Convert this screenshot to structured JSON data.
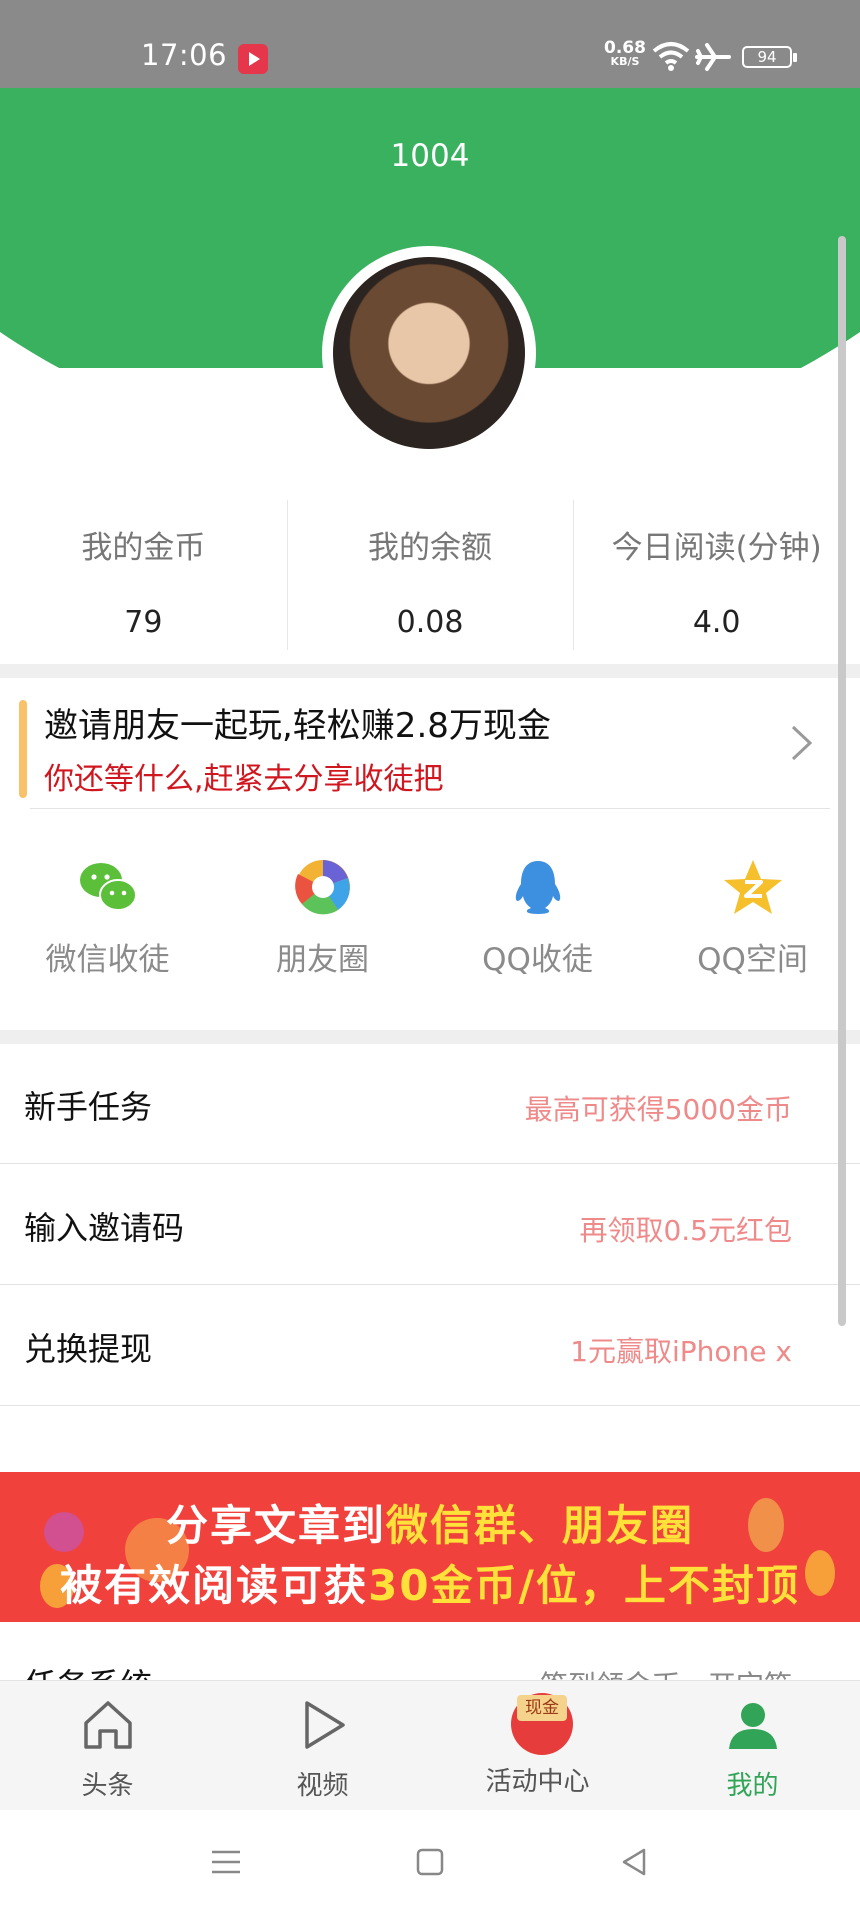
{
  "status_bar": {
    "time": "17:06",
    "speed_value": "0.68",
    "speed_unit": "KB/S",
    "battery": "94"
  },
  "header": {
    "title": "1004"
  },
  "stats": [
    {
      "label": "我的金币",
      "value": "79"
    },
    {
      "label": "我的余额",
      "value": "0.08"
    },
    {
      "label": "今日阅读(分钟)",
      "value": "4.0"
    }
  ],
  "invite": {
    "title": "邀请朋友一起玩,轻松赚2.8万现金",
    "subtitle": "你还等什么,赶紧去分享收徒把"
  },
  "share": [
    {
      "label": "微信收徒",
      "icon": "wechat-icon"
    },
    {
      "label": "朋友圈",
      "icon": "moments-icon"
    },
    {
      "label": "QQ收徒",
      "icon": "qq-icon"
    },
    {
      "label": "QQ空间",
      "icon": "qzone-icon"
    }
  ],
  "menu": [
    {
      "name": "新手任务",
      "hint": "最高可获得5000金币"
    },
    {
      "name": "输入邀请码",
      "hint": "再领取0.5元红包"
    },
    {
      "name": "兑换提现",
      "hint": "1元赢取iPhone x"
    }
  ],
  "banner": {
    "line1_a": "分享文章到",
    "line1_b": "微信群、朋友圈",
    "line2_a": "被有效阅读可获",
    "line2_b": "30金币/位，上不封顶"
  },
  "partial_row": {
    "name": "任务系统",
    "hint": "签到领金币，开宝箱"
  },
  "tabs": [
    {
      "label": "头条",
      "icon": "home-icon"
    },
    {
      "label": "视频",
      "icon": "play-icon"
    },
    {
      "label": "活动中心",
      "icon": "cash-badge-icon",
      "badge": "现金"
    },
    {
      "label": "我的",
      "icon": "profile-icon"
    }
  ],
  "colors": {
    "brand_green": "#3ab15f",
    "accent_red": "#d0161f",
    "hint_pink": "#ef8a8a",
    "banner_red": "#f1413d",
    "banner_yellow": "#ffe13a"
  }
}
